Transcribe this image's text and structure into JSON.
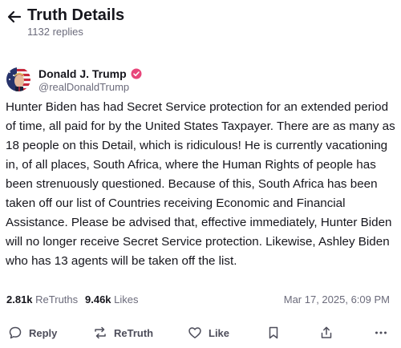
{
  "header": {
    "title": "Truth Details",
    "replies": "1132 replies",
    "back_icon": "arrow-left-icon"
  },
  "author": {
    "name": "Donald J. Trump",
    "handle": "@realDonaldTrump",
    "verified_color": "#e8457a",
    "avatar_icon": "avatar-flag-icon"
  },
  "post": {
    "text": "Hunter Biden has had Secret Service protection for an extended period of time, all paid for by the United States Taxpayer. There are as many as 18 people on this Detail, which is ridiculous! He is currently vacationing in, of all places, South Africa, where the Human Rights of people has been strenuously questioned. Because of this, South Africa has been taken off our list of Countries receiving Economic and Financial Assistance. Please be advised that, effective immediately, Hunter Biden will no longer receive Secret Service protection. Likewise, Ashley Biden who has 13 agents will be taken off the list."
  },
  "stats": {
    "retruths_count": "2.81k",
    "retruths_label": "ReTruths",
    "likes_count": "9.46k",
    "likes_label": "Likes",
    "timestamp": "Mar 17, 2025, 6:09 PM"
  },
  "actions": {
    "reply_label": "Reply",
    "retruth_label": "ReTruth",
    "like_label": "Like"
  },
  "colors": {
    "text": "#16161d",
    "muted": "#6b6b7b",
    "accent": "#e8457a"
  }
}
